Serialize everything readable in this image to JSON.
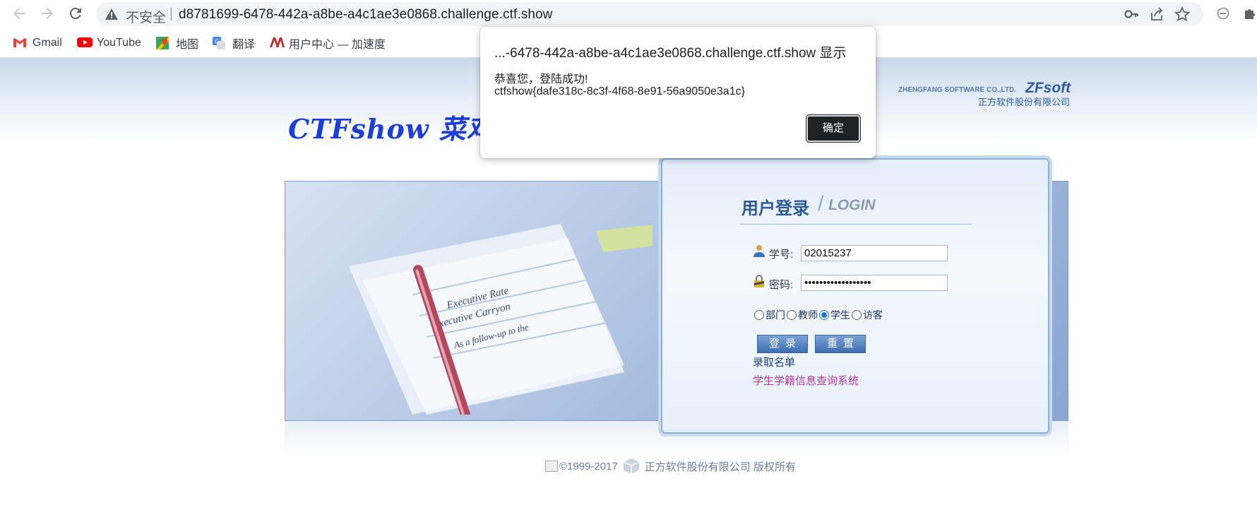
{
  "browser": {
    "security_label": "不安全",
    "separator": "|",
    "url": "d8781699-6478-442a-a8be-a4c1ae3e0868.challenge.ctf.show",
    "icons": [
      "back-arrow-icon",
      "forward-arrow-icon",
      "reload-icon",
      "warning-icon",
      "key-icon",
      "share-icon",
      "star-icon",
      "minus-circle-icon",
      "extensions-icon"
    ]
  },
  "bookmarks": [
    {
      "label": "Gmail",
      "icon": "gmail-icon"
    },
    {
      "label": "YouTube",
      "icon": "youtube-icon"
    },
    {
      "label": "地图",
      "icon": "maps-icon"
    },
    {
      "label": "翻译",
      "icon": "translate-icon"
    },
    {
      "label": "用户中心 — 加速度",
      "icon": "accel-icon"
    }
  ],
  "page": {
    "logo_text": "CTFshow 菜鸡学",
    "brand_en": "ZHENGFANG SOFTWARE CO.,LTD.",
    "brand_name": "ZFsoft",
    "brand_cn": "正方软件股份有限公司",
    "banner_text_lines": [
      "Executive Rate",
      "Executive Carryon",
      "As a follow-up to the"
    ]
  },
  "login": {
    "title": "用户登录",
    "title_en": "LOGIN",
    "student_id_label": "学号:",
    "student_id_value": "02015237",
    "password_label": "密码:",
    "password_value": "••••••••••••••••••",
    "roles": [
      {
        "label": "部门",
        "checked": false
      },
      {
        "label": "教师",
        "checked": false
      },
      {
        "label": "学生",
        "checked": true
      },
      {
        "label": "访客",
        "checked": false
      }
    ],
    "login_button": "登录",
    "reset_button": "重置",
    "admission_link": "录取名单",
    "system_link": "学生学籍信息查询系统"
  },
  "footer": {
    "copyright": "©1999-2017",
    "company": "正方软件股份有限公司 版权所有"
  },
  "dialog": {
    "title": "...-6478-442a-a8be-a4c1ae3e0868.challenge.ctf.show 显示",
    "message_line1": "恭喜您，登陆成功!",
    "message_line2": "ctfshow{dafe318c-8c3f-4f68-8e91-56a9050e3a1c}",
    "ok_button": "确定"
  }
}
